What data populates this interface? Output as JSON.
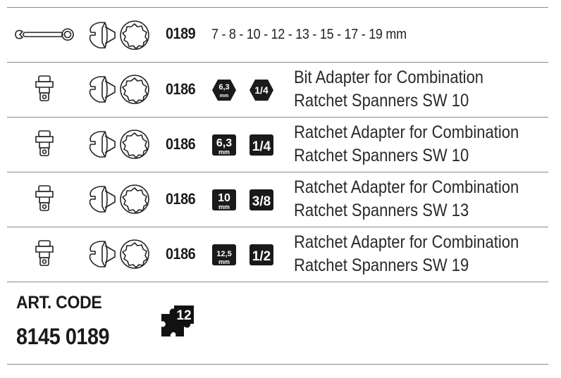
{
  "rows": [
    {
      "code": "0189",
      "sizes": "7 - 8 - 10 - 12 - 13 - 15 - 17 - 19 mm",
      "tool_icon": "ratcheting-combination-wrench-icon",
      "wrench_icon": "open-end-ring-spanner-icon"
    },
    {
      "code": "0186",
      "badge_left": "6,3",
      "badge_left_unit": "mm",
      "badge_right": "1/4",
      "desc_line1": "Bit Adapter for Combination",
      "desc_line2": "Ratchet Spanners SW 10",
      "tool_icon": "adapter-icon"
    },
    {
      "code": "0186",
      "badge_left": "6,3",
      "badge_left_unit": "mm",
      "badge_right": "1/4",
      "desc_line1": "Ratchet Adapter for Combination",
      "desc_line2": "Ratchet Spanners SW 10",
      "tool_icon": "adapter-icon"
    },
    {
      "code": "0186",
      "badge_left": "10",
      "badge_left_unit": "mm",
      "badge_right": "3/8",
      "desc_line1": "Ratchet Adapter for Combination",
      "desc_line2": "Ratchet Spanners SW 13",
      "tool_icon": "adapter-icon"
    },
    {
      "code": "0186",
      "badge_left": "12,5",
      "badge_left_unit": "mm",
      "badge_right": "1/2",
      "desc_line1": "Ratchet Adapter for Combination",
      "desc_line2": "Ratchet Spanners SW 19",
      "tool_icon": "adapter-icon"
    }
  ],
  "footer": {
    "art_code_label": "ART. CODE",
    "art_code_number": "8145 0189",
    "piece_count": "12",
    "piece_icon": "puzzle-piece-icon"
  },
  "colors": {
    "text": "#1a1a1a",
    "badge": "#1a1a1a",
    "rule": "#8a8a8a"
  }
}
